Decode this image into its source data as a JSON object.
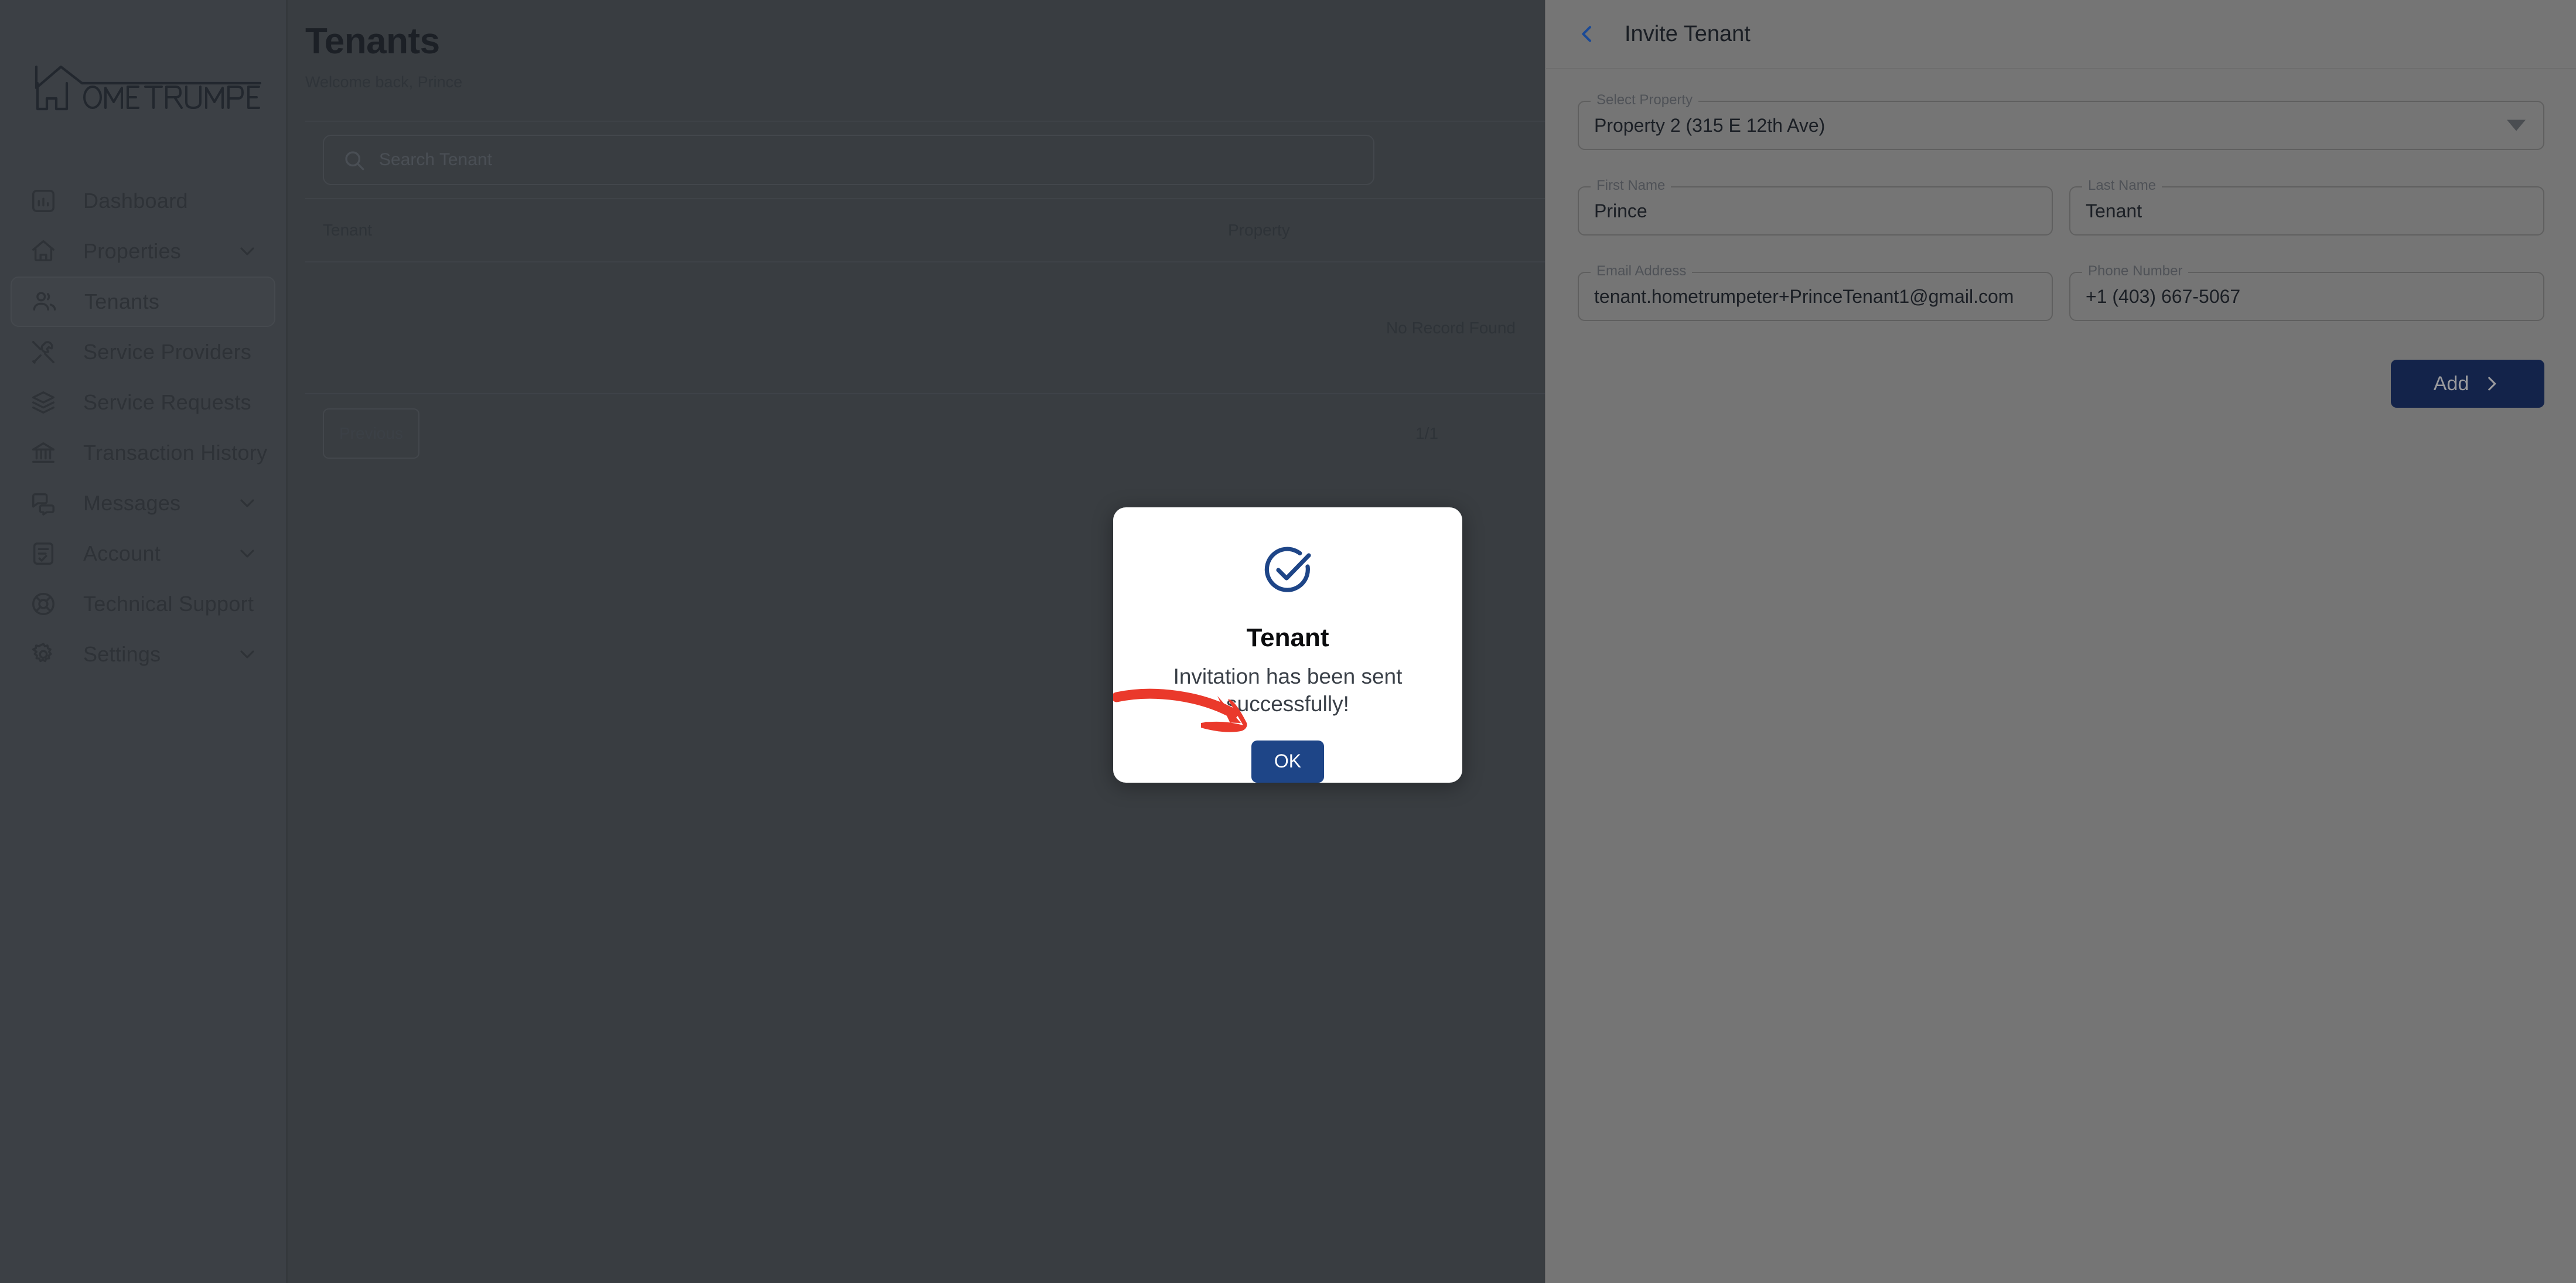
{
  "brand": {
    "name": "OME TRUMPETER",
    "full_name": "HOME TRUMPETER"
  },
  "sidebar": {
    "items": [
      {
        "label": "Dashboard",
        "icon": "chart-bar-icon",
        "expandable": false,
        "active": false
      },
      {
        "label": "Properties",
        "icon": "home-icon",
        "expandable": true,
        "active": false
      },
      {
        "label": "Tenants",
        "icon": "users-icon",
        "expandable": false,
        "active": true
      },
      {
        "label": "Service Providers",
        "icon": "tools-icon",
        "expandable": false,
        "active": false
      },
      {
        "label": "Service Requests",
        "icon": "layers-icon",
        "expandable": false,
        "active": false
      },
      {
        "label": "Transaction History",
        "icon": "bank-icon",
        "expandable": false,
        "active": false
      },
      {
        "label": "Messages",
        "icon": "chat-bubbles-icon",
        "expandable": true,
        "active": false
      },
      {
        "label": "Account",
        "icon": "clipboard-check-icon",
        "expandable": true,
        "active": false
      },
      {
        "label": "Technical Support",
        "icon": "lifebuoy-icon",
        "expandable": false,
        "active": false
      },
      {
        "label": "Settings",
        "icon": "gear-icon",
        "expandable": true,
        "active": false
      }
    ]
  },
  "main": {
    "title": "Tenants",
    "subtitle": "Welcome back, Prince",
    "search": {
      "placeholder": "Search Tenant",
      "value": "",
      "icon": "search-icon"
    },
    "table": {
      "columns": [
        "Tenant",
        "Property"
      ],
      "rows": [],
      "empty_text": "No Record Found"
    },
    "pagination": {
      "previous_label": "Previous",
      "page_indicator": "1/1"
    }
  },
  "drawer": {
    "title": "Invite Tenant",
    "back_icon": "chevron-left-icon",
    "fields": [
      {
        "label": "Select Property",
        "value": "Property 2 (315 E 12th Ave)",
        "type": "select",
        "icon": "chevron-down-icon"
      },
      {
        "label": "First Name",
        "value": "Prince",
        "type": "text"
      },
      {
        "label": "Last Name",
        "value": "Tenant",
        "type": "text"
      },
      {
        "label": "Email Address",
        "value": "tenant.hometrumpeter+PrinceTenant1@gmail.com",
        "type": "email"
      },
      {
        "label": "Phone Number",
        "value": "+1 (403) 667-5067",
        "type": "tel"
      }
    ],
    "submit": {
      "label": "Add",
      "icon": "chevron-right-icon"
    }
  },
  "modal": {
    "icon": "check-circle-icon",
    "title": "Tenant",
    "message": "Invitation has been sent successfully!",
    "ok_label": "OK"
  },
  "annotation": {
    "type": "curved-arrow",
    "points_to": "ok-button"
  },
  "colors": {
    "accent_blue": "#1e4587",
    "button_navy": "#13234a",
    "annotation_red": "#ea392b",
    "sidebar_bg": "#3c4045",
    "main_bg": "#393d41",
    "drawer_bg": "#757575",
    "modal_bg": "#ffffff"
  }
}
